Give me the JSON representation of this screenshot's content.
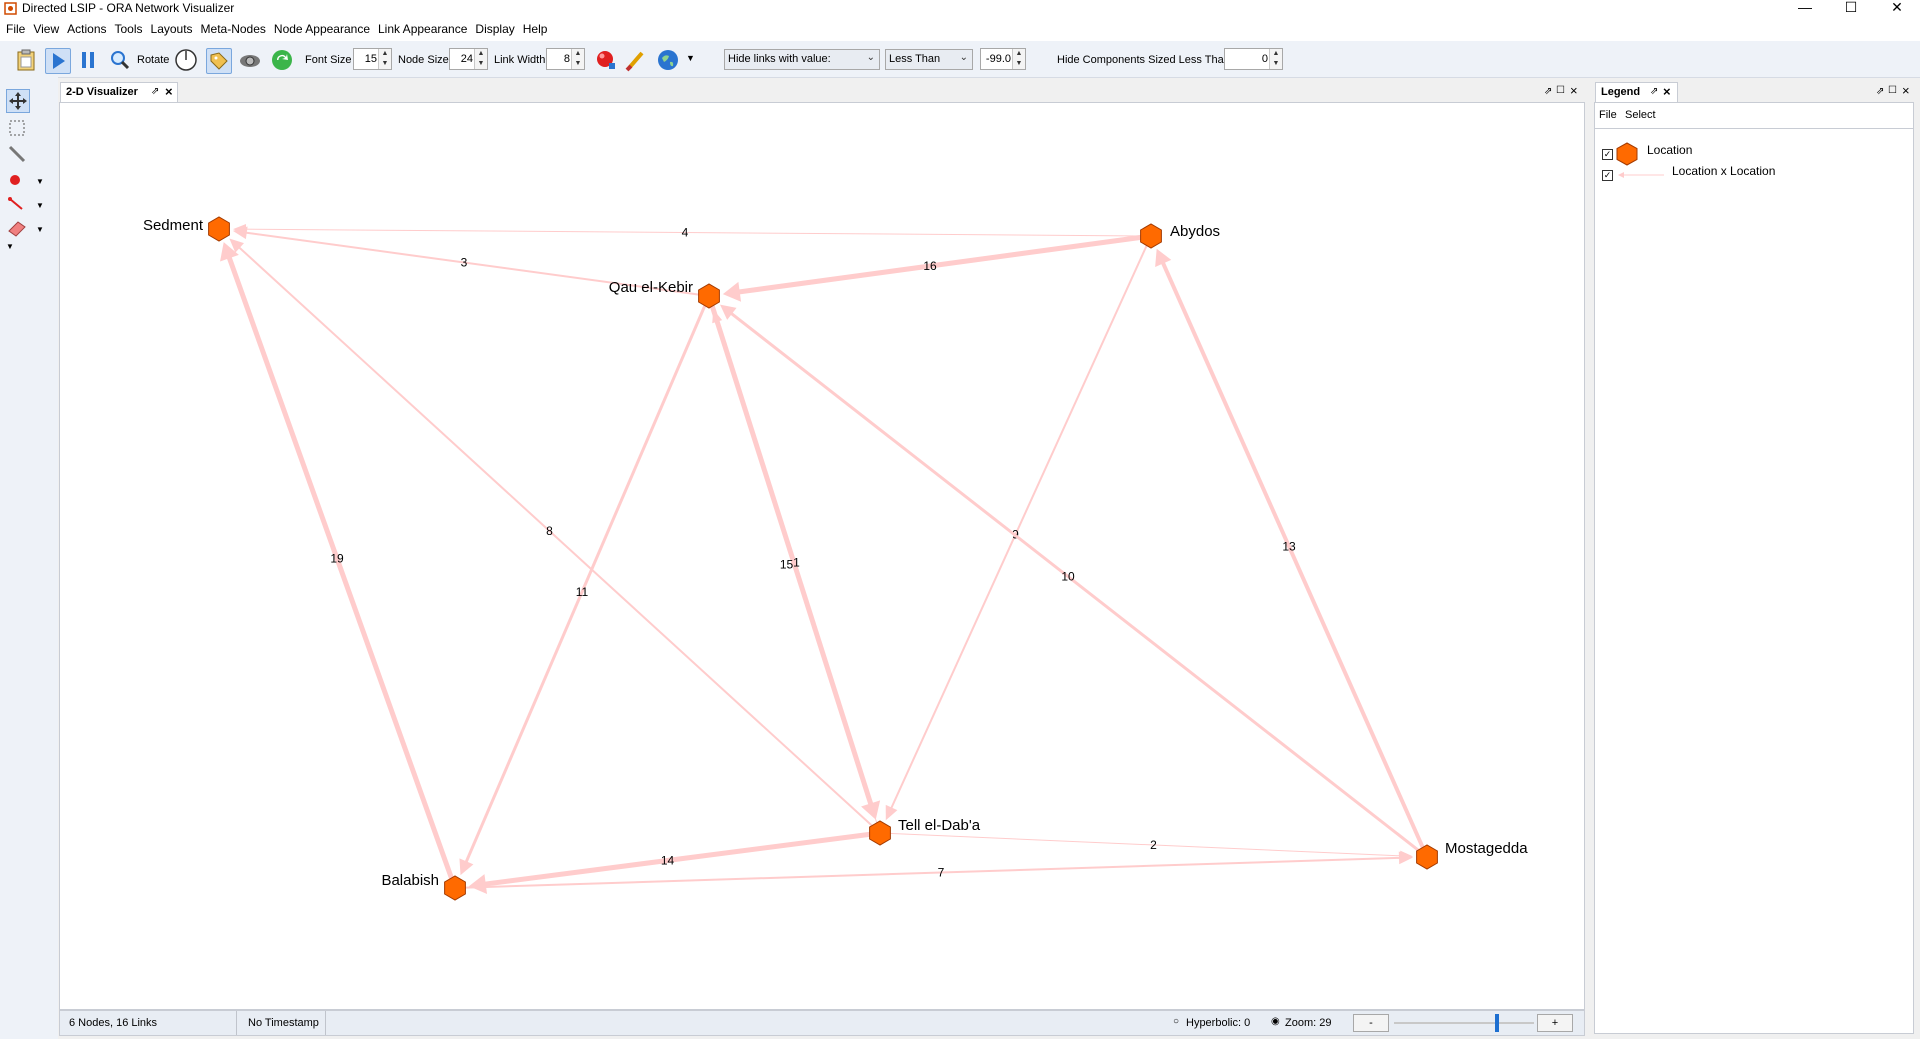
{
  "window": {
    "title": "Directed LSIP - ORA Network Visualizer",
    "controls": [
      "—",
      "☐",
      "✕"
    ]
  },
  "menu": [
    "File",
    "View",
    "Actions",
    "Tools",
    "Layouts",
    "Meta-Nodes",
    "Node Appearance",
    "Link Appearance",
    "Display",
    "Help"
  ],
  "toolbar": {
    "rotate_label": "Rotate",
    "font_size_label": "Font Size",
    "font_size_value": "15",
    "node_size_label": "Node Size",
    "node_size_value": "24",
    "link_width_label": "Link Width",
    "link_width_value": "8",
    "hide_links_select": "Hide links with value:",
    "comparison_select": "Less Than",
    "threshold_value": "-99.0",
    "hide_components_label": "Hide Components Sized Less Than",
    "hide_components_value": "0"
  },
  "visualizer": {
    "tab_label": "2-D Visualizer",
    "nodes": [
      {
        "id": "sedment",
        "label": "Sedment"
      },
      {
        "id": "abydos",
        "label": "Abydos"
      },
      {
        "id": "qau",
        "label": "Qau el-Kebir"
      },
      {
        "id": "tell",
        "label": "Tell el-Dab'a"
      },
      {
        "id": "balabish",
        "label": "Balabish"
      },
      {
        "id": "mostagedda",
        "label": "Mostagedda"
      }
    ],
    "links": [
      {
        "source": "abydos",
        "target": "sedment",
        "label": "4"
      },
      {
        "source": "qau",
        "target": "sedment",
        "label": "3"
      },
      {
        "source": "abydos",
        "target": "qau",
        "label": "16"
      },
      {
        "source": "balabish",
        "target": "sedment",
        "label": "19"
      },
      {
        "source": "tell",
        "target": "sedment",
        "label": "8"
      },
      {
        "source": "qau",
        "target": "balabish",
        "label": "11"
      },
      {
        "source": "qau",
        "target": "tell",
        "label": "15"
      },
      {
        "source": "tell",
        "target": "qau",
        "label": "1"
      },
      {
        "source": "abydos",
        "target": "tell",
        "label": "9"
      },
      {
        "source": "mostagedda",
        "target": "qau",
        "label": "10"
      },
      {
        "source": "mostagedda",
        "target": "abydos",
        "label": "13"
      },
      {
        "source": "tell",
        "target": "balabish",
        "label": "14"
      },
      {
        "source": "tell",
        "target": "mostagedda",
        "label": "2"
      },
      {
        "source": "balabish",
        "target": "mostagedda",
        "label": "7"
      }
    ]
  },
  "status": {
    "counts": "6 Nodes, 16 Links",
    "timestamp": "No Timestamp",
    "hyperbolic": "Hyperbolic: 0",
    "zoom": "Zoom: 29",
    "zoom_minus": "-",
    "zoom_plus": "+"
  },
  "legend": {
    "tab_label": "Legend",
    "menu": [
      "File",
      "Select"
    ],
    "items": [
      {
        "label": "Location",
        "checked": true
      },
      {
        "label": "Location x Location",
        "checked": true
      }
    ]
  },
  "colors": {
    "node_fill": "#ff6a00",
    "node_stroke": "#a33a00",
    "edge": "#ffcccc",
    "accent": "#1e6fd0"
  }
}
